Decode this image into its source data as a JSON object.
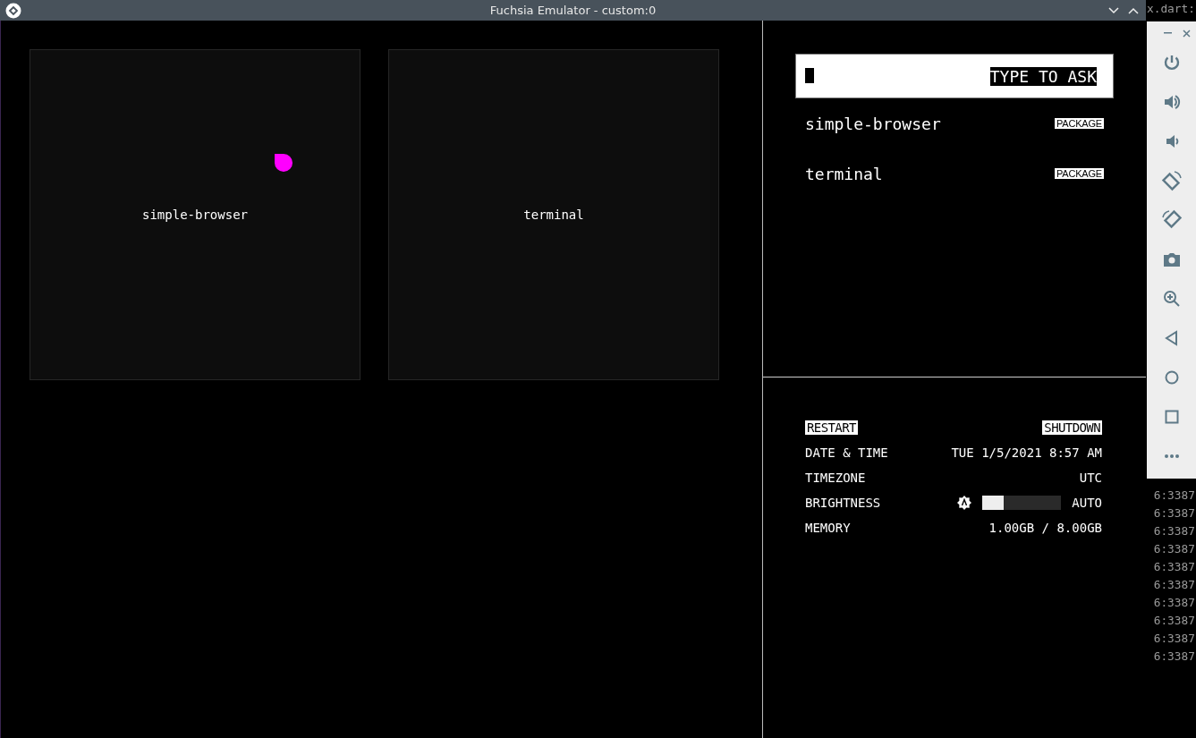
{
  "window": {
    "title": "Fuchsia Emulator - custom:0"
  },
  "tiles": [
    {
      "label": "simple-browser",
      "touch_marker": true
    },
    {
      "label": "terminal",
      "touch_marker": false
    }
  ],
  "ask": {
    "placeholder": "TYPE TO ASK"
  },
  "suggestions": [
    {
      "name": "simple-browser",
      "type": "PACKAGE"
    },
    {
      "name": "terminal",
      "type": "PACKAGE"
    }
  ],
  "settings": {
    "actions": [
      "RESTART",
      "SHUTDOWN"
    ],
    "rows": [
      {
        "kind": "text",
        "label": "DATE & TIME",
        "value": "TUE 1/5/2021 8:57 AM"
      },
      {
        "kind": "text",
        "label": "TIMEZONE",
        "value": "UTC"
      },
      {
        "kind": "slider",
        "label": "BRIGHTNESS",
        "level": 0.27,
        "value": "AUTO"
      },
      {
        "kind": "text",
        "label": "MEMORY",
        "value": "1.00GB / 8.00GB"
      }
    ]
  },
  "terminal": {
    "lines": [
      "x.dart:",
      "6:3387",
      "6:3387",
      "6:3387",
      "6:3387",
      "6:3387",
      "6:3387",
      "6:3387",
      "6:3387",
      "6:3387",
      "6:3387"
    ]
  }
}
